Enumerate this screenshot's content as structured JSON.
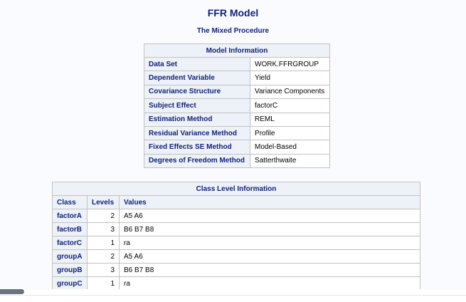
{
  "title": "FFR Model",
  "subtitle": "The Mixed Procedure",
  "model_info": {
    "caption": "Model Information",
    "rows": [
      {
        "label": "Data Set",
        "value": "WORK.FFRGROUP"
      },
      {
        "label": "Dependent Variable",
        "value": "Yield"
      },
      {
        "label": "Covariance Structure",
        "value": "Variance Components"
      },
      {
        "label": "Subject Effect",
        "value": "factorC"
      },
      {
        "label": "Estimation Method",
        "value": "REML"
      },
      {
        "label": "Residual Variance Method",
        "value": "Profile"
      },
      {
        "label": "Fixed Effects SE Method",
        "value": "Model-Based"
      },
      {
        "label": "Degrees of Freedom Method",
        "value": "Satterthwaite"
      }
    ]
  },
  "class_info": {
    "caption": "Class Level Information",
    "headers": [
      "Class",
      "Levels",
      "Values"
    ],
    "rows": [
      {
        "class": "factorA",
        "levels": "2",
        "values": "A5 A6"
      },
      {
        "class": "factorB",
        "levels": "3",
        "values": "B6 B7 B8"
      },
      {
        "class": "factorC",
        "levels": "1",
        "values": "ra"
      },
      {
        "class": "groupA",
        "levels": "2",
        "values": "A5 A6"
      },
      {
        "class": "groupB",
        "levels": "3",
        "values": "B6 B7 B8"
      },
      {
        "class": "groupC",
        "levels": "1",
        "values": "ra"
      }
    ]
  }
}
